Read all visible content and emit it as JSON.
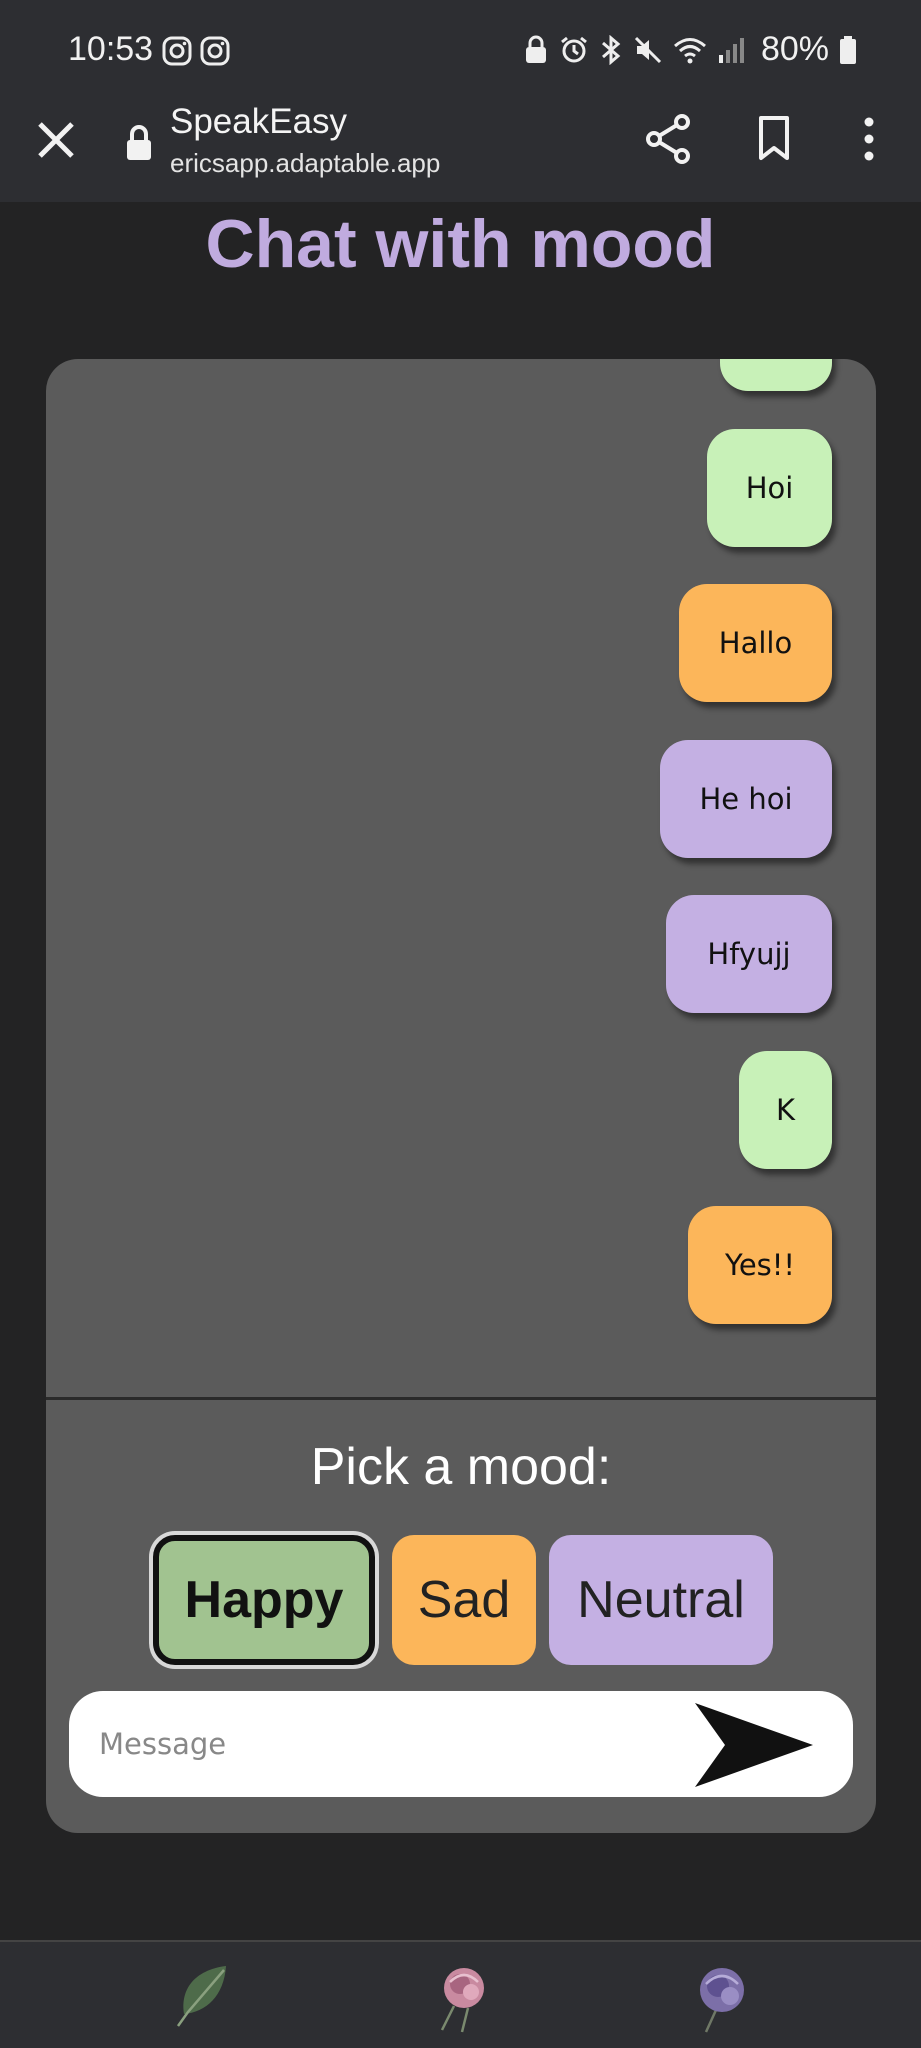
{
  "status_bar": {
    "time": "10:53",
    "battery": "80%"
  },
  "browser": {
    "site_title": "SpeakEasy",
    "url": "ericsapp.adaptable.app"
  },
  "page": {
    "title": "Chat with mood"
  },
  "chat": {
    "messages": [
      {
        "text": "",
        "mood": "happy"
      },
      {
        "text": "Hoi",
        "mood": "happy"
      },
      {
        "text": "Hallo",
        "mood": "sad"
      },
      {
        "text": "He hoi",
        "mood": "neutral"
      },
      {
        "text": "Hfyujj",
        "mood": "neutral"
      },
      {
        "text": "K",
        "mood": "happy"
      },
      {
        "text": "Yes!!",
        "mood": "sad"
      }
    ]
  },
  "mood_picker": {
    "label": "Pick a mood:",
    "options": [
      "Happy",
      "Sad",
      "Neutral"
    ],
    "selected": "Happy"
  },
  "composer": {
    "placeholder": "Message"
  },
  "colors": {
    "title": "#c0abdf",
    "happy": "#c8f1b8",
    "happy_button": "#a1c390",
    "sad": "#fcb65a",
    "neutral": "#c4b0e3"
  },
  "bottom_nav": {
    "items": [
      "leaf-icon",
      "pink-rose-icon",
      "purple-rose-icon"
    ]
  }
}
